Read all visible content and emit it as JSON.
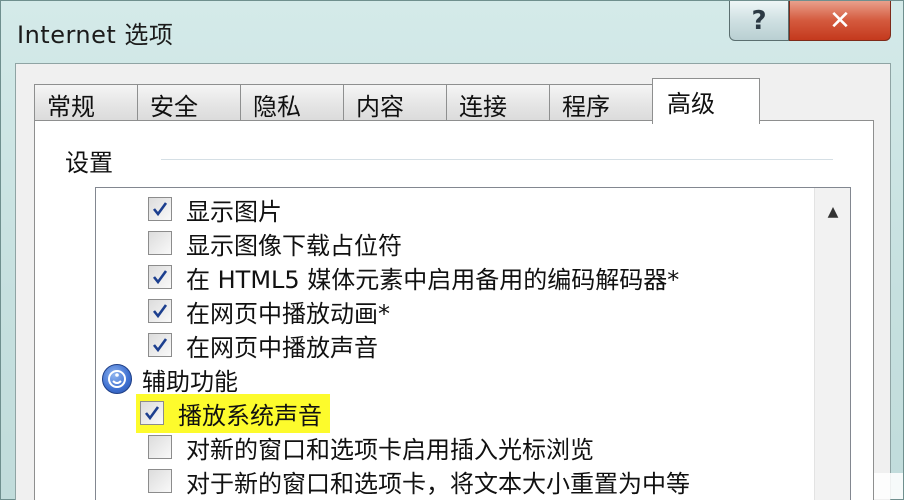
{
  "window": {
    "title": "Internet 选项",
    "help_label": "?",
    "close_label": "✕"
  },
  "tabs": [
    {
      "label": "常规"
    },
    {
      "label": "安全"
    },
    {
      "label": "隐私"
    },
    {
      "label": "内容"
    },
    {
      "label": "连接"
    },
    {
      "label": "程序"
    },
    {
      "label": "高级",
      "active": true
    }
  ],
  "settings": {
    "group_label": "设置",
    "category_label": "辅助功能",
    "category_icon": "accessibility-icon",
    "items": [
      {
        "label": "显示图片",
        "checked": true
      },
      {
        "label": "显示图像下载占位符",
        "checked": false
      },
      {
        "label": "在 HTML5 媒体元素中启用备用的编码解码器*",
        "checked": true
      },
      {
        "label": "在网页中播放动画*",
        "checked": true
      },
      {
        "label": "在网页中播放声音",
        "checked": true
      },
      {
        "label": "播放系统声音",
        "checked": true,
        "highlighted": true
      },
      {
        "label": "对新的窗口和选项卡启用插入光标浏览",
        "checked": false
      },
      {
        "label": "对于新的窗口和选项卡，将文本大小重置为中等",
        "checked": false
      }
    ]
  },
  "colors": {
    "highlight": "#fdfb2c",
    "close_button": "#c4391d"
  }
}
